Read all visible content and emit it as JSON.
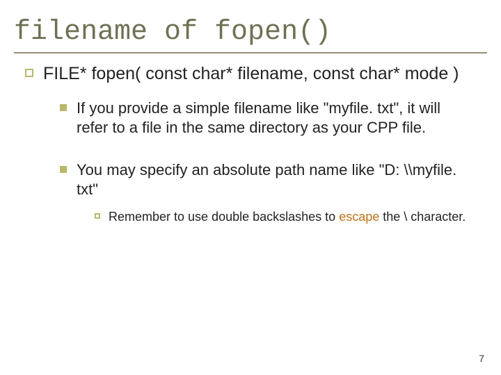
{
  "slide": {
    "title": "filename of fopen()",
    "lvl1": {
      "text": "FILE* fopen( const char* filename, const char* mode )"
    },
    "lvl2a": {
      "text": "If you provide a simple filename like \"myfile. txt\", it will refer to a file in the same directory as your CPP file."
    },
    "lvl2b": {
      "text": "You may specify an absolute path name like \"D: \\\\myfile. txt\""
    },
    "lvl3": {
      "pre": "Remember to use double backslashes to ",
      "emph": "escape",
      "post": " the \\ character."
    },
    "pagenum": "7"
  }
}
